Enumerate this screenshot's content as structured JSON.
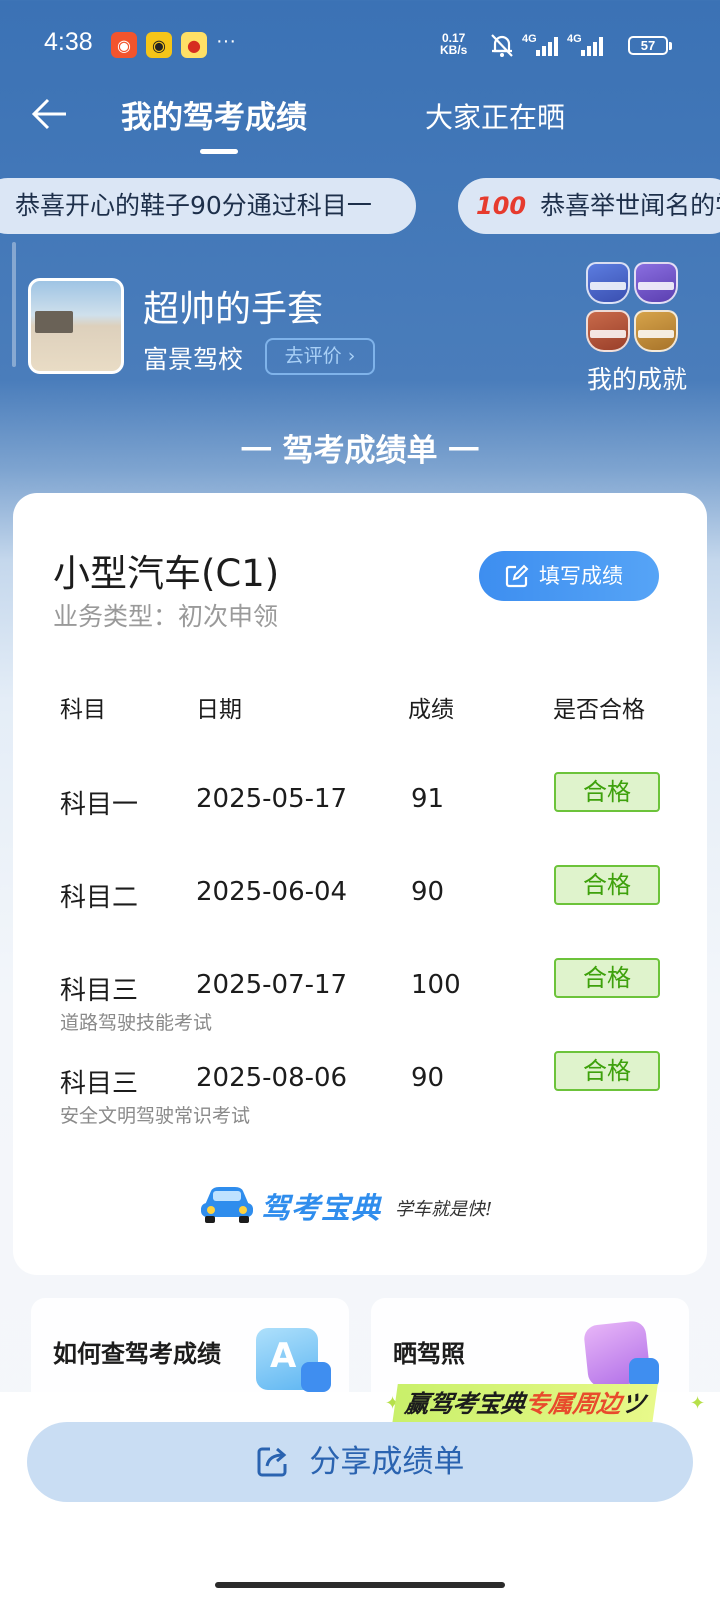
{
  "status_bar": {
    "time": "4:38",
    "more": "···",
    "speed_value": "0.17",
    "speed_unit": "KB/s",
    "signal1": "4G",
    "signal2": "4G",
    "battery": "57"
  },
  "nav": {
    "title": "我的驾考成绩",
    "tab2": "大家正在晒"
  },
  "ticker": [
    {
      "emoji": "",
      "text": "恭喜开心的鞋子90分通过科目一"
    },
    {
      "emoji": "100",
      "text": "恭喜举世闻名的学"
    }
  ],
  "profile": {
    "name": "超帅的手套",
    "school": "富景驾校",
    "rate_label": "去评价",
    "achievements_label": "我的成就"
  },
  "section_title": "一 驾考成绩单 一",
  "card": {
    "car_type": "小型汽车(C1)",
    "business": "业务类型：初次申领",
    "fill_button": "填写成绩",
    "headers": [
      "科目",
      "日期",
      "成绩",
      "是否合格"
    ],
    "rows": [
      {
        "subject": "科目一",
        "date": "2025-05-17",
        "score": "91",
        "status": "合格",
        "note": ""
      },
      {
        "subject": "科目二",
        "date": "2025-06-04",
        "score": "90",
        "status": "合格",
        "note": ""
      },
      {
        "subject": "科目三",
        "date": "2025-07-17",
        "score": "100",
        "status": "合格",
        "note": "道路驾驶技能考试"
      },
      {
        "subject": "科目三",
        "date": "2025-08-06",
        "score": "90",
        "status": "合格",
        "note": "安全文明驾驶常识考试"
      }
    ],
    "brand_name": "驾考宝典",
    "brand_slogan": "学车就是快!"
  },
  "promos": {
    "left_label": "如何查驾考成绩",
    "right_label": "晒驾照",
    "banner_text": "赢驾考宝典",
    "banner_highlight": "专属周边"
  },
  "share_label": "分享成绩单",
  "colors": {
    "header_blue": "#3b72b5",
    "accent": "#3d8ef0",
    "pass_green": "#3ea10c",
    "pass_bg": "#dff3cc"
  }
}
